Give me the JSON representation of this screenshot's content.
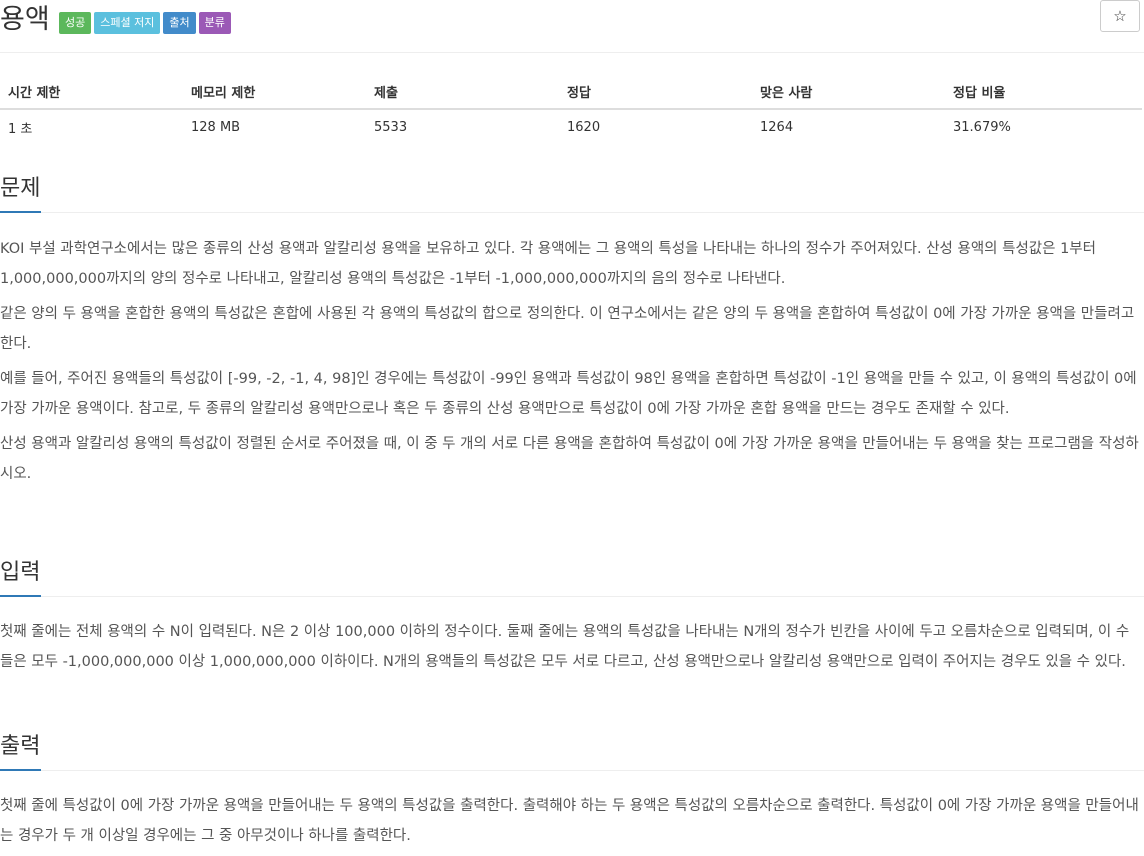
{
  "problem": {
    "title": "용액",
    "labels": [
      "성공",
      "스페셜 저지",
      "출처",
      "분류"
    ],
    "star_icon": "☆"
  },
  "stats": {
    "headers": [
      "시간 제한",
      "메모리 제한",
      "제출",
      "정답",
      "맞은 사람",
      "정답 비율"
    ],
    "values": [
      "1 초",
      "128 MB",
      "5533",
      "1620",
      "1264",
      "31.679%"
    ]
  },
  "sections": {
    "description": {
      "heading": "문제",
      "paragraphs": [
        "KOI 부설 과학연구소에서는 많은 종류의 산성 용액과 알칼리성 용액을 보유하고 있다. 각 용액에는 그 용액의 특성을 나타내는 하나의 정수가 주어져있다. 산성 용액의 특성값은 1부터 1,000,000,000까지의 양의 정수로 나타내고, 알칼리성 용액의 특성값은 -1부터 -1,000,000,000까지의 음의 정수로 나타낸다.",
        "같은 양의 두 용액을 혼합한 용액의 특성값은 혼합에 사용된 각 용액의 특성값의 합으로 정의한다. 이 연구소에서는 같은 양의 두 용액을 혼합하여 특성값이 0에 가장 가까운 용액을 만들려고 한다.",
        "예를 들어, 주어진 용액들의 특성값이 [-99, -2, -1, 4, 98]인 경우에는 특성값이 -99인 용액과 특성값이 98인 용액을 혼합하면 특성값이 -1인 용액을 만들 수 있고, 이 용액의 특성값이 0에 가장 가까운 용액이다. 참고로, 두 종류의 알칼리성 용액만으로나 혹은 두 종류의 산성 용액만으로 특성값이 0에 가장 가까운 혼합 용액을 만드는 경우도 존재할 수 있다.",
        "산성 용액과 알칼리성 용액의 특성값이 정렬된 순서로 주어졌을 때, 이 중 두 개의 서로 다른 용액을 혼합하여 특성값이 0에 가장 가까운 용액을 만들어내는 두 용액을 찾는 프로그램을 작성하시오."
      ]
    },
    "input": {
      "heading": "입력",
      "paragraphs": [
        "첫째 줄에는 전체 용액의 수 N이 입력된다. N은 2 이상 100,000 이하의 정수이다. 둘째 줄에는 용액의 특성값을 나타내는 N개의 정수가 빈칸을 사이에 두고 오름차순으로 입력되며, 이 수들은 모두 -1,000,000,000 이상 1,000,000,000 이하이다. N개의 용액들의 특성값은 모두 서로 다르고, 산성 용액만으로나 알칼리성 용액만으로 입력이 주어지는 경우도 있을 수 있다."
      ]
    },
    "output": {
      "heading": "출력",
      "paragraphs": [
        "첫째 줄에 특성값이 0에 가장 가까운 용액을 만들어내는 두 용액의 특성값을 출력한다. 출력해야 하는 두 용액은 특성값의 오름차순으로 출력한다. 특성값이 0에 가장 가까운 용액을 만들어내는 경우가 두 개 이상일 경우에는 그 중 아무것이나 하나를 출력한다."
      ]
    }
  },
  "colors": {
    "label_success": "#5cb85c",
    "label_info": "#5bc0de",
    "label_primary": "#428bca",
    "label_purple": "#9b59b6",
    "heading_underline": "#2f79b6"
  }
}
